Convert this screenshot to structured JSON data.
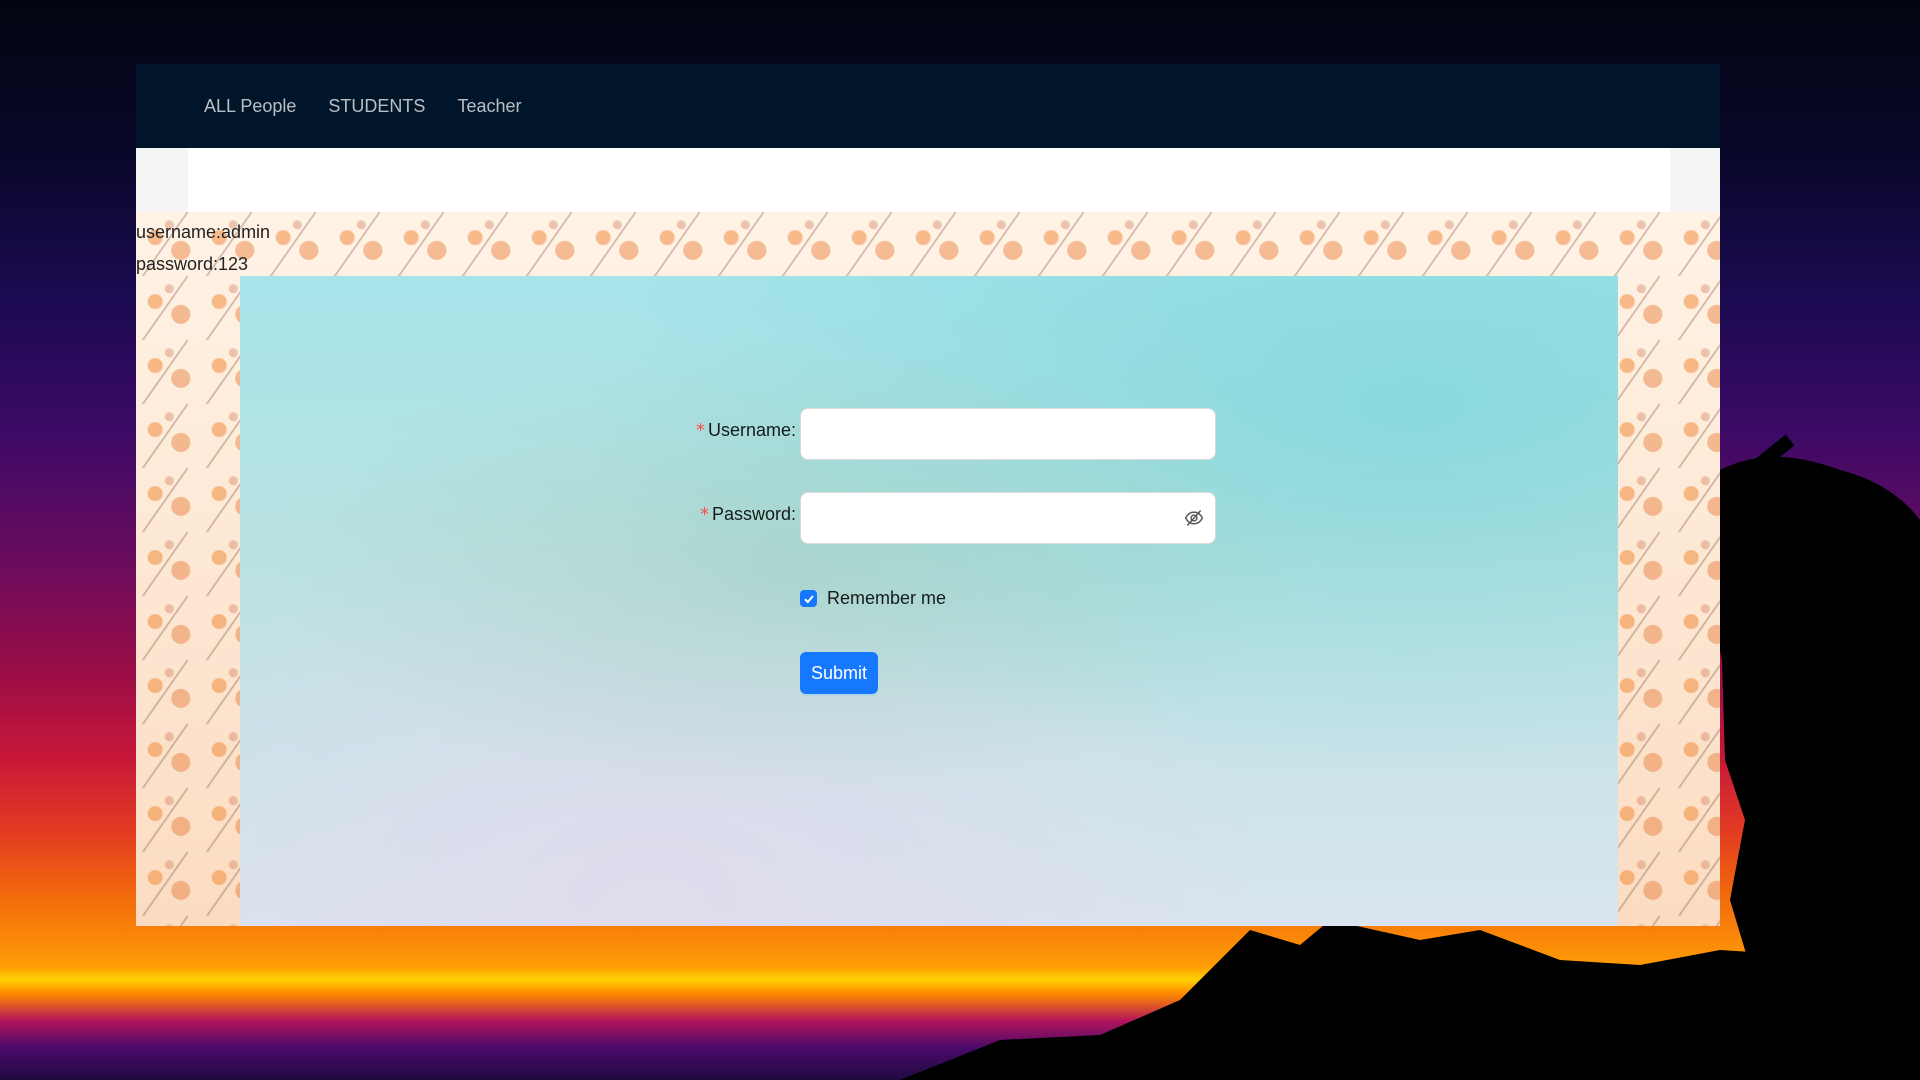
{
  "nav": {
    "items": [
      "ALL People",
      "STUDENTS",
      "Teacher"
    ]
  },
  "credentials_hint": {
    "username": "username:admin",
    "password": "password:123"
  },
  "form": {
    "username": {
      "label": "Username",
      "colon": ":",
      "required_mark": "*",
      "value": ""
    },
    "password": {
      "label": "Password",
      "colon": ":",
      "required_mark": "*",
      "value": "",
      "icon": "eye-invisible-icon"
    },
    "remember": {
      "label": "Remember me",
      "checked": true,
      "icon": "check-icon"
    },
    "submit_label": "Submit"
  },
  "colors": {
    "navbar": "#001529",
    "primary": "#1677ff",
    "required": "#ff4d4f"
  }
}
